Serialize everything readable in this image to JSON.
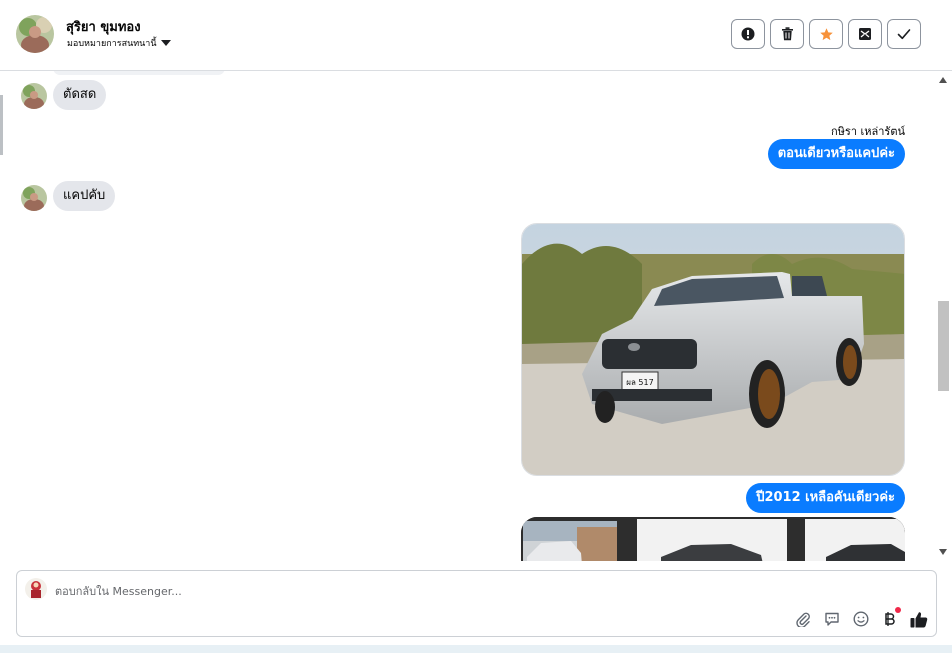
{
  "header": {
    "contact_name": "สุริยา ขุมทอง",
    "assign_label": "มอบหมายการสนทนานี้",
    "actions": [
      {
        "icon": "alert-icon",
        "label": "Report"
      },
      {
        "icon": "trash-icon",
        "label": "Delete"
      },
      {
        "icon": "star-icon",
        "label": "Star"
      },
      {
        "icon": "mark-unread-icon",
        "label": "Mark unread"
      },
      {
        "icon": "check-icon",
        "label": "Done"
      }
    ]
  },
  "messages": [
    {
      "side": "in",
      "text": "ตัดสด"
    },
    {
      "side": "out",
      "sender": "กษิรา เหล่ารัตน์",
      "text": "ตอนเดียวหรือแคปค่ะ"
    },
    {
      "side": "in",
      "text": "แคปคับ"
    },
    {
      "side": "out",
      "type": "image",
      "alt": "ผล 517"
    },
    {
      "side": "out",
      "text": "ปี2012 เหลือคันเดียวค่ะ"
    },
    {
      "side": "out",
      "type": "image-strip"
    }
  ],
  "composer": {
    "placeholder": "ตอบกลับใน Messenger...",
    "tools": [
      "attachment-icon",
      "saved-replies-icon",
      "emoji-icon",
      "payment-icon",
      "like-icon"
    ]
  },
  "colors": {
    "accent": "#0a7cff",
    "incoming_bubble": "#e4e6eb",
    "star": "#f7923a",
    "notification_dot": "#f02849"
  }
}
